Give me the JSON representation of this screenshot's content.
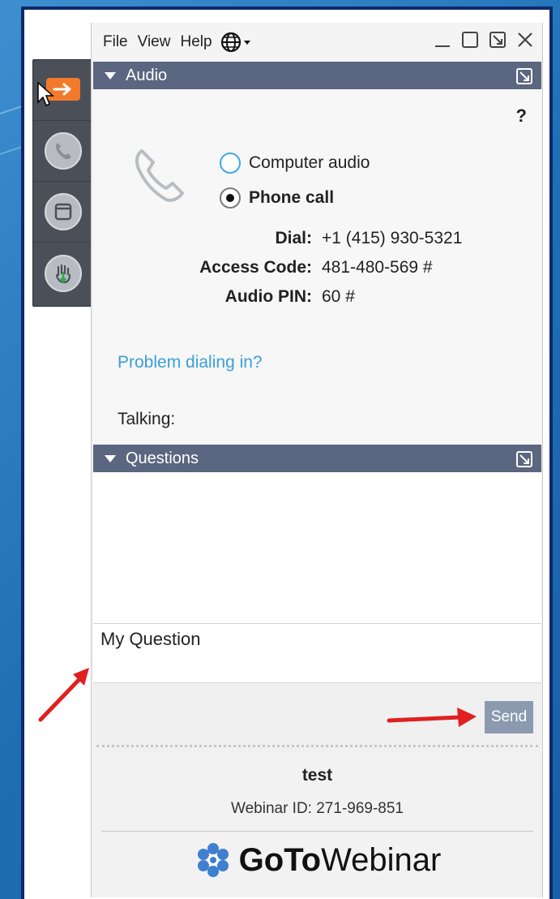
{
  "menu": {
    "file": "File",
    "view": "View",
    "help": "Help"
  },
  "audio": {
    "header": "Audio",
    "help_mark": "?",
    "option_computer": "Computer audio",
    "option_phone": "Phone call",
    "selected": "Phone call",
    "dial_label": "Dial:",
    "dial_value": "+1 (415) 930-5321",
    "access_label": "Access Code:",
    "access_value": "481-480-569 #",
    "pin_label": "Audio PIN:",
    "pin_value": "60 #",
    "problem_link": "Problem dialing in?",
    "talking_label": "Talking:"
  },
  "questions": {
    "header": "Questions",
    "input_value": "My Question",
    "send_label": "Send"
  },
  "footer": {
    "title": "test",
    "webinar_id": "Webinar ID: 271-969-851",
    "brand_bold": "GoTo",
    "brand_light": "Webinar"
  },
  "colors": {
    "panel_header": "#5b6680",
    "link": "#3a9fd9",
    "send_button": "#8c9ab0",
    "control_orange": "#f27b2b",
    "annotation_arrow": "#e02020",
    "brand_icon": "#3f7fd0"
  },
  "icons": {
    "menu_globe": "globe-icon",
    "audio_phone": "phone-icon",
    "ctrl_1": "arrow-right-icon",
    "ctrl_2": "phone-icon",
    "ctrl_3": "window-icon",
    "ctrl_4": "raise-hand-icon"
  }
}
